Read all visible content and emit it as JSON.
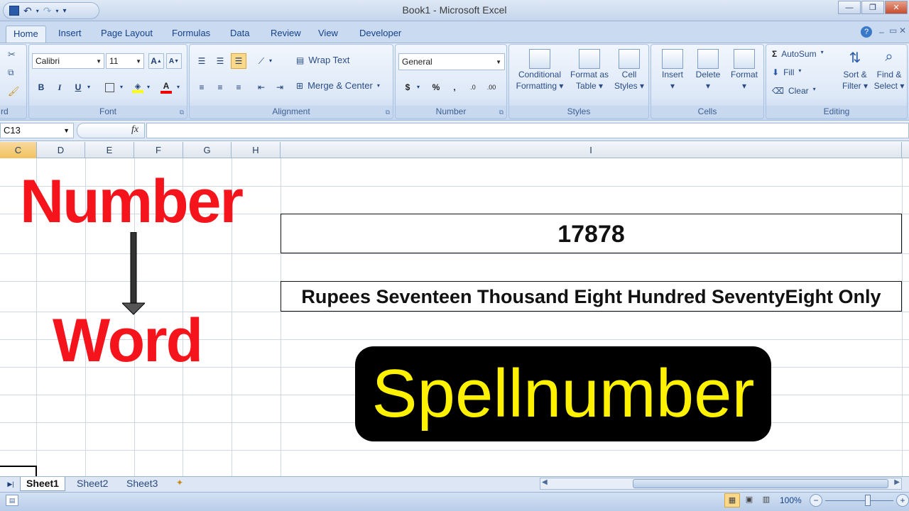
{
  "window": {
    "title": "Book1 - Microsoft Excel"
  },
  "tabs": [
    "Home",
    "Insert",
    "Page Layout",
    "Formulas",
    "Data",
    "Review",
    "View",
    "Developer"
  ],
  "font_group": {
    "font_name": "Calibri",
    "font_size": "11",
    "label": "Font",
    "bold": "B",
    "italic": "I",
    "underline": "U",
    "grow": "A",
    "shrink": "A"
  },
  "clipboard_group": {
    "label": "rd"
  },
  "alignment_group": {
    "label": "Alignment",
    "wrap_text": "Wrap Text",
    "merge_center": "Merge & Center"
  },
  "number_group": {
    "label": "Number",
    "format": "General",
    "currency": "$",
    "percent": "%",
    "comma": ",",
    "inc_decimal": ".0",
    "dec_decimal": ".00"
  },
  "styles_group": {
    "label": "Styles",
    "conditional_formatting": [
      "Conditional",
      "Formatting"
    ],
    "format_as_table": [
      "Format as",
      "Table"
    ],
    "cell_styles": [
      "Cell",
      "Styles"
    ]
  },
  "cells_group": {
    "label": "Cells",
    "insert": "Insert",
    "delete": "Delete",
    "format": "Format"
  },
  "editing_group": {
    "label": "Editing",
    "autosum": "AutoSum",
    "fill": "Fill",
    "clear": "Clear",
    "sort_filter": [
      "Sort &",
      "Filter"
    ],
    "find_select": [
      "Find &",
      "Select"
    ]
  },
  "formula_bar": {
    "name_box": "C13",
    "fx": "fx",
    "formula": ""
  },
  "columns": [
    "C",
    "D",
    "E",
    "F",
    "G",
    "H",
    "I"
  ],
  "sheet": {
    "title_word1": "Number",
    "title_word2": "Word",
    "number_value": "17878",
    "words_value": "Rupees Seventeen Thousand Eight Hundred SeventyEight Only",
    "banner": "Spellnumber"
  },
  "sheet_tabs": [
    "Sheet1",
    "Sheet2",
    "Sheet3"
  ],
  "status": {
    "zoom": "100%"
  },
  "colors": {
    "accent_red": "#f5141b",
    "banner_text": "#fff200",
    "ribbon_blue": "#15428b"
  }
}
